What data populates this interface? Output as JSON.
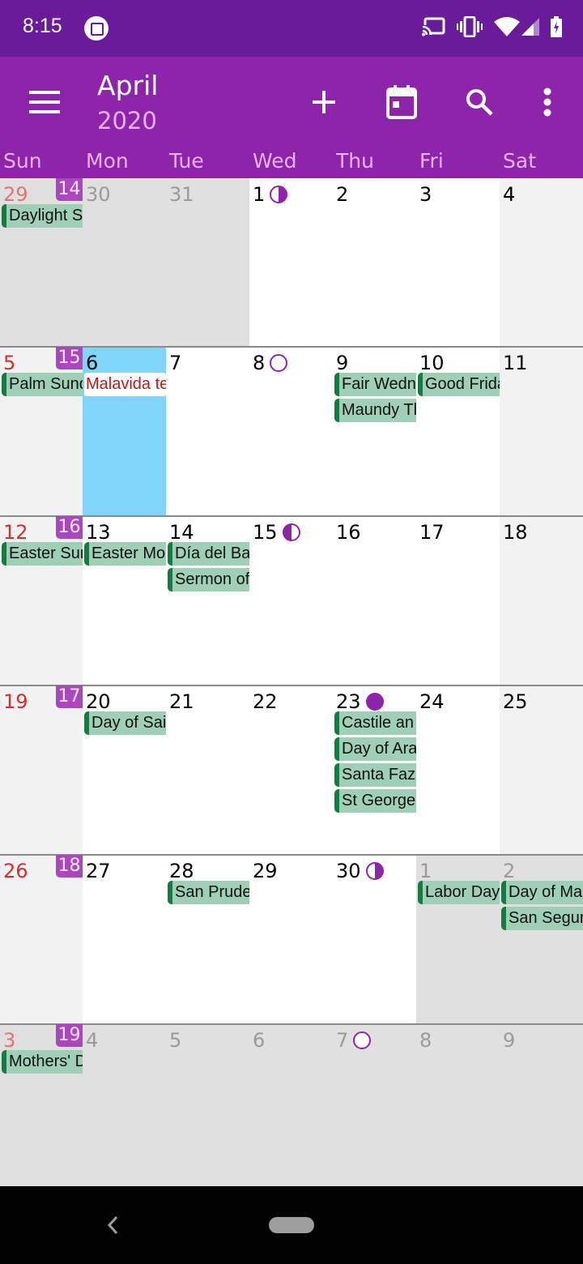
{
  "status_bar": {
    "time": "8:15",
    "icons": [
      "notification-app-icon",
      "cast-icon",
      "vibrate-icon",
      "wifi-icon",
      "signal-icon",
      "battery-charging-icon"
    ]
  },
  "toolbar": {
    "month": "April",
    "year": "2020",
    "actions": [
      "menu-icon",
      "add-icon",
      "today-icon",
      "search-icon",
      "more-icon"
    ]
  },
  "colors": {
    "status_bar": "#691b99",
    "app_bar": "#8e24aa",
    "week_number": "#ab47bc",
    "event_bg": "#9fd0b5",
    "event_stripe": "#157a43",
    "today": "#81d4fa",
    "sunday": "#d32f2f"
  },
  "weekdays": [
    "Sun",
    "Mon",
    "Tue",
    "Wed",
    "Thu",
    "Fri",
    "Sat"
  ],
  "weeks": [
    {
      "week_number": "14",
      "days": [
        {
          "d": "29",
          "out": true,
          "events": [
            "Daylight S"
          ]
        },
        {
          "d": "30",
          "out": true,
          "events": []
        },
        {
          "d": "31",
          "out": true,
          "events": []
        },
        {
          "d": "1",
          "moon": "first",
          "events": []
        },
        {
          "d": "2",
          "events": []
        },
        {
          "d": "3",
          "events": []
        },
        {
          "d": "4",
          "events": []
        }
      ]
    },
    {
      "week_number": "15",
      "days": [
        {
          "d": "5",
          "events": [
            "Palm Sund"
          ]
        },
        {
          "d": "6",
          "today": true,
          "events": [
            {
              "text": "Malavida te",
              "style": "red"
            }
          ]
        },
        {
          "d": "7",
          "events": []
        },
        {
          "d": "8",
          "moon": "new",
          "events": []
        },
        {
          "d": "9",
          "events": [
            "Fair Wedn",
            "Maundy Th"
          ]
        },
        {
          "d": "10",
          "events": [
            "Good Frida"
          ]
        },
        {
          "d": "11",
          "events": []
        }
      ]
    },
    {
      "week_number": "16",
      "days": [
        {
          "d": "12",
          "events": [
            "Easter Sun"
          ]
        },
        {
          "d": "13",
          "events": [
            "Easter Mo"
          ]
        },
        {
          "d": "14",
          "events": [
            "Día del Ba",
            "Sermon of"
          ]
        },
        {
          "d": "15",
          "moon": "last",
          "events": []
        },
        {
          "d": "16",
          "events": []
        },
        {
          "d": "17",
          "events": []
        },
        {
          "d": "18",
          "events": []
        }
      ]
    },
    {
      "week_number": "17",
      "days": [
        {
          "d": "19",
          "events": []
        },
        {
          "d": "20",
          "events": [
            "Day of Sai"
          ]
        },
        {
          "d": "21",
          "events": []
        },
        {
          "d": "22",
          "events": []
        },
        {
          "d": "23",
          "moon": "full",
          "events": [
            "Castile an",
            "Day of Ara",
            "Santa Faz",
            "St George'"
          ]
        },
        {
          "d": "24",
          "events": []
        },
        {
          "d": "25",
          "events": []
        }
      ]
    },
    {
      "week_number": "18",
      "days": [
        {
          "d": "26",
          "events": []
        },
        {
          "d": "27",
          "events": []
        },
        {
          "d": "28",
          "events": [
            "San Prude"
          ]
        },
        {
          "d": "29",
          "events": []
        },
        {
          "d": "30",
          "moon": "first",
          "events": []
        },
        {
          "d": "1",
          "out": true,
          "events": [
            "Labor Day"
          ]
        },
        {
          "d": "2",
          "out": true,
          "events": [
            "Day of Ma",
            "San Segur"
          ]
        }
      ]
    },
    {
      "week_number": "19",
      "days": [
        {
          "d": "3",
          "out": true,
          "events": [
            "Mothers' D"
          ]
        },
        {
          "d": "4",
          "out": true,
          "events": []
        },
        {
          "d": "5",
          "out": true,
          "events": []
        },
        {
          "d": "6",
          "out": true,
          "events": []
        },
        {
          "d": "7",
          "out": true,
          "moon": "new",
          "events": []
        },
        {
          "d": "8",
          "out": true,
          "events": []
        },
        {
          "d": "9",
          "out": true,
          "events": []
        }
      ]
    }
  ],
  "nav_bar": {
    "buttons": [
      "back-button",
      "home-button"
    ]
  }
}
